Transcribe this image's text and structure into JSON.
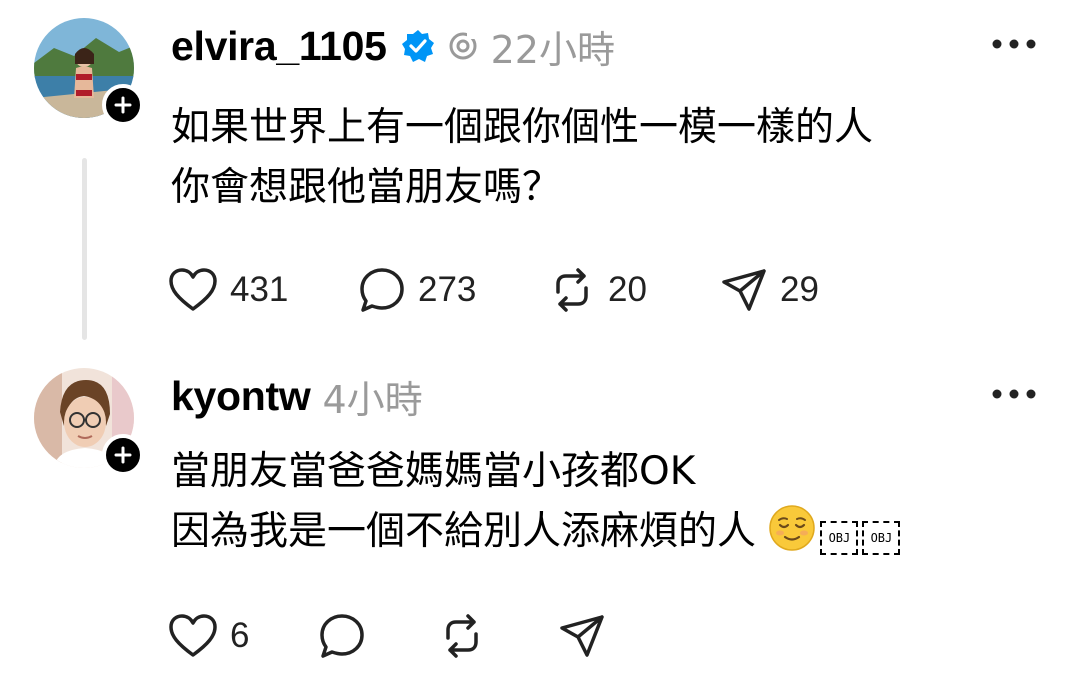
{
  "posts": [
    {
      "username": "elvira_1105",
      "verified": true,
      "time": "22小時",
      "lines": [
        "如果世界上有一個跟你個性一模一樣的人",
        "你會想跟他當朋友嗎？"
      ],
      "counts": {
        "likes": "431",
        "replies": "273",
        "reposts": "20",
        "shares": "29"
      }
    },
    {
      "username": "kyontw",
      "time": "4小時",
      "lines": [
        "當朋友當爸爸媽媽當小孩都OK",
        "因為我是一個不給別人添麻煩的人"
      ],
      "obj_markers": [
        "OBJ",
        "OBJ"
      ],
      "counts": {
        "likes": "6"
      }
    }
  ],
  "icons": {
    "verified": "verified-badge-icon",
    "follow": "plus-icon",
    "more": "more-horizontal-icon",
    "like": "heart-icon",
    "reply": "comment-bubble-icon",
    "repost": "repost-icon",
    "share": "send-icon",
    "emoji": "relieved-face-emoji"
  },
  "colors": {
    "verified_blue": "#0095f6",
    "meta_gray": "#9a9a9a",
    "thread_line": "#e5e5e5"
  }
}
